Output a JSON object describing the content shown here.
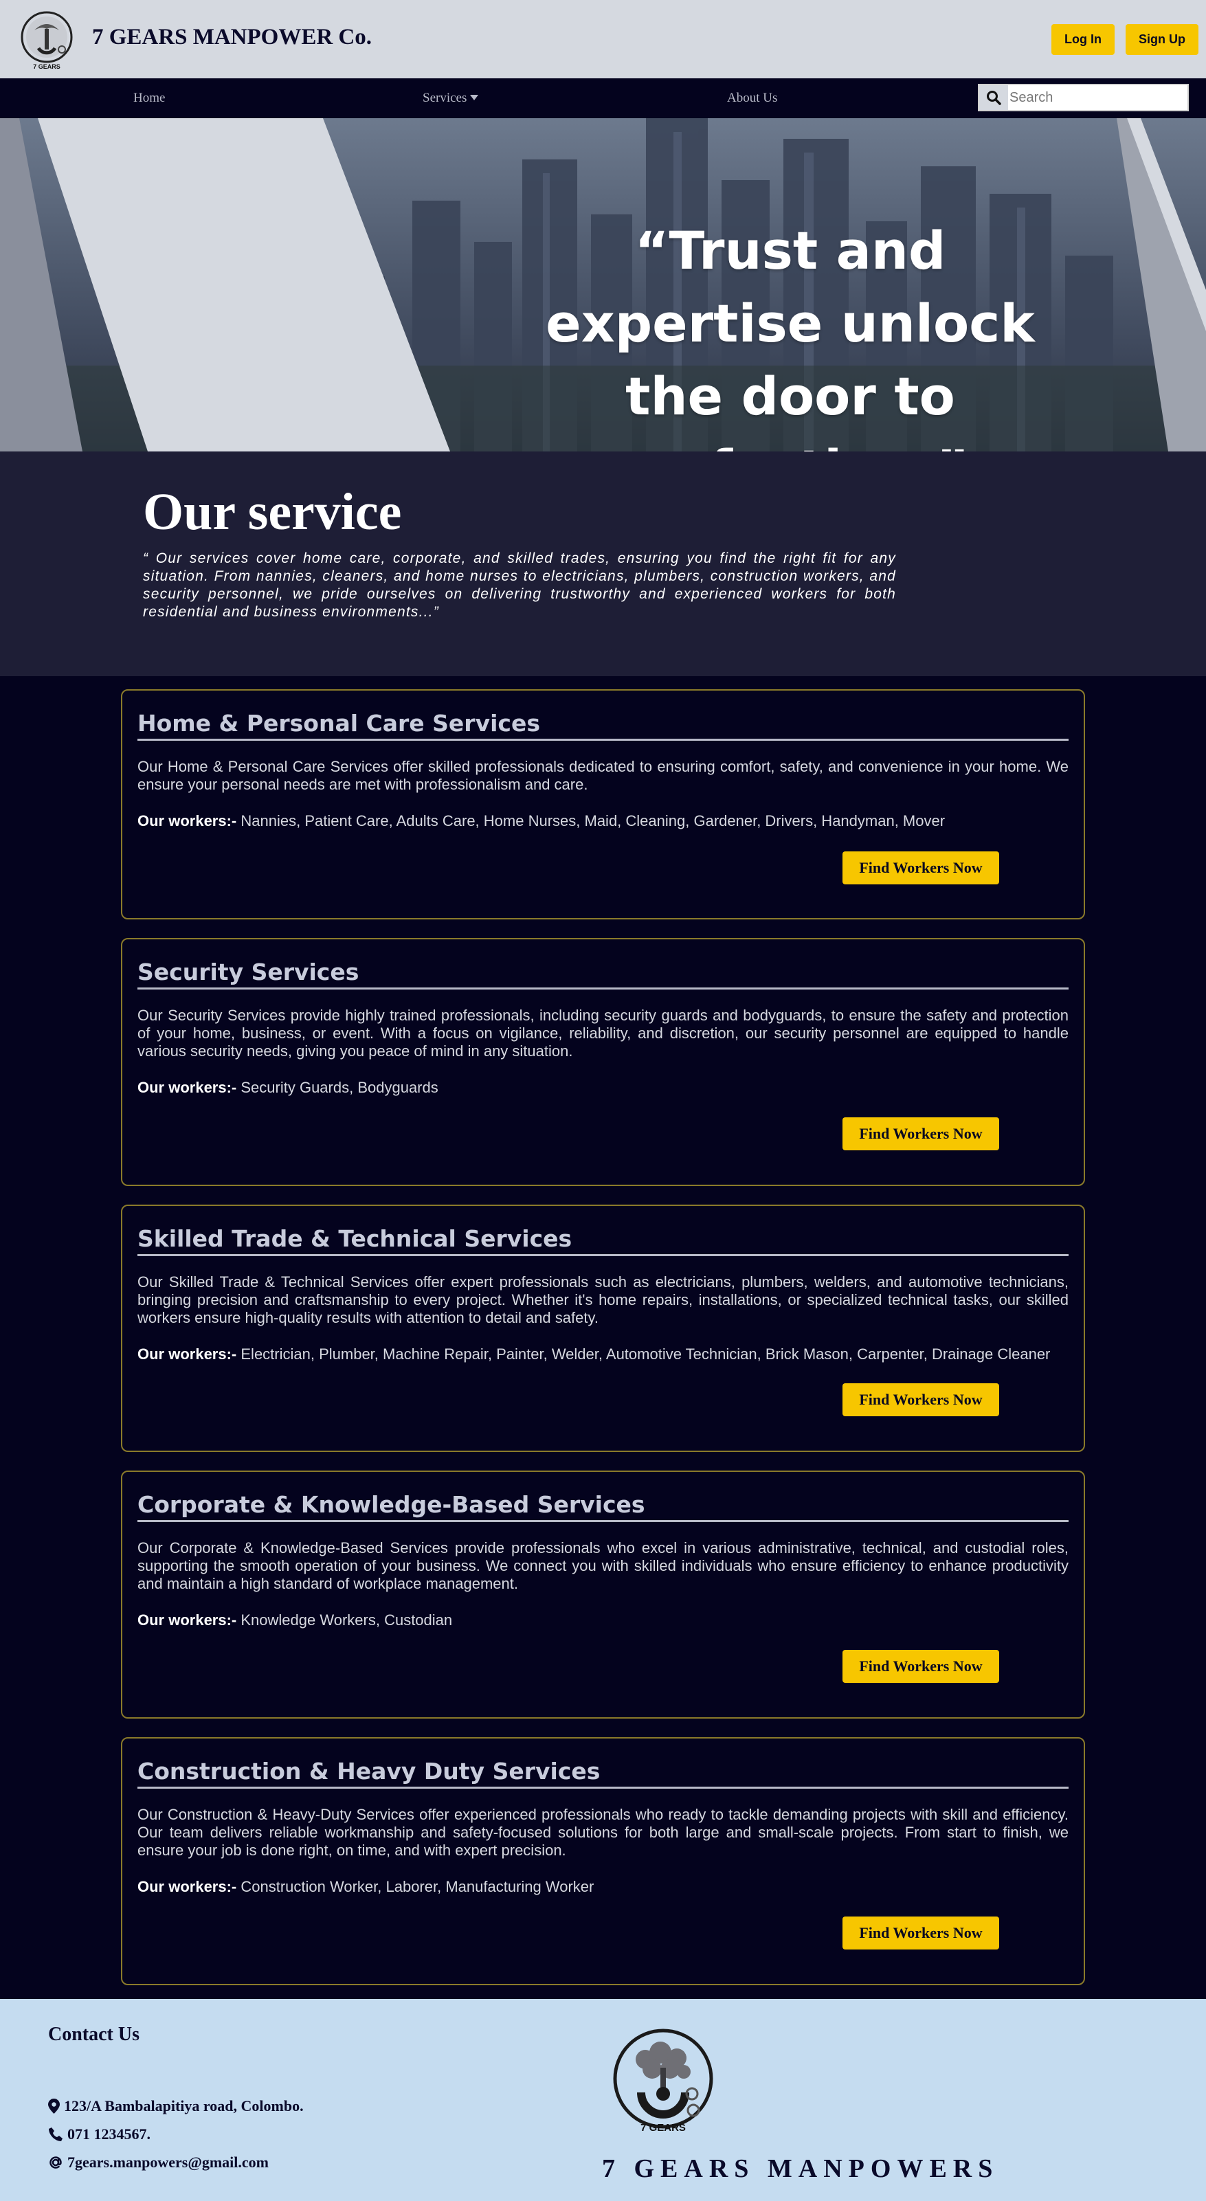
{
  "header": {
    "brand": "7 GEARS MANPOWER Co.",
    "logo_text": "7 GEARS",
    "login_label": "Log In",
    "signup_label": "Sign Up"
  },
  "nav": {
    "home": "Home",
    "services": "Services",
    "about": "About Us",
    "search_placeholder": "Search"
  },
  "hero": {
    "quote": "“Trust and expertise unlock the door to perfection.”"
  },
  "intro": {
    "title": "Our service",
    "text": "“ Our services cover home care, corporate, and skilled trades, ensuring you find the right fit for any situation. From nannies, cleaners, and home nurses to electricians, plumbers, construction workers, and security personnel, we pride ourselves on delivering trustworthy and experienced workers for both residential and business environments...”"
  },
  "services": [
    {
      "title": "Home & Personal Care Services",
      "description": "Our Home & Personal Care Services offer skilled professionals dedicated to ensuring comfort, safety, and convenience in your home. We ensure your personal needs are met with professionalism and care.",
      "workers_label": "Our workers:-",
      "workers": " Nannies, Patient Care, Adults Care, Home Nurses, Maid, Cleaning, Gardener, Drivers, Handyman, Mover",
      "button": "Find Workers Now"
    },
    {
      "title": "Security Services",
      "description": "Our Security Services provide highly trained professionals, including security guards and bodyguards, to ensure the safety and protection of your home, business, or event. With a focus on vigilance, reliability, and discretion, our security personnel are equipped to handle various security needs, giving you peace of mind in any situation.",
      "workers_label": "Our workers:-",
      "workers": " Security Guards, Bodyguards",
      "button": "Find Workers Now"
    },
    {
      "title": "Skilled Trade & Technical Services",
      "description": "Our Skilled Trade & Technical Services offer expert professionals such as electricians, plumbers, welders, and automotive technicians, bringing precision and craftsmanship to every project. Whether it's home repairs, installations, or specialized technical tasks, our skilled workers ensure high-quality results with attention to detail and safety.",
      "workers_label": "Our workers:-",
      "workers": " Electrician, Plumber, Machine Repair, Painter, Welder, Automotive Technician, Brick Mason, Carpenter, Drainage Cleaner",
      "button": "Find Workers Now"
    },
    {
      "title": "Corporate & Knowledge-Based Services",
      "description": "Our Corporate & Knowledge-Based Services provide professionals who excel in various administrative, technical, and custodial roles, supporting the smooth operation of your business. We connect you with skilled individuals who ensure efficiency to enhance productivity and maintain a high standard of workplace management.",
      "workers_label": "Our workers:-",
      "workers": " Knowledge Workers, Custodian",
      "button": "Find Workers Now"
    },
    {
      "title": "Construction & Heavy Duty Services",
      "description": "Our Construction & Heavy-Duty Services offer experienced professionals who ready to tackle demanding projects with skill and efficiency. Our team delivers reliable workmanship and safety-focused solutions for both large and small-scale projects. From start to finish, we ensure your job is done right, on time, and with expert precision.",
      "workers_label": "Our workers:-",
      "workers": " Construction Worker, Laborer, Manufacturing Worker",
      "button": "Find Workers Now"
    }
  ],
  "footer": {
    "contact_title": "Contact Us",
    "address": "123/A Bambalapitiya road, Colombo.",
    "phone": "071 1234567.",
    "email": "7gears.manpowers@gmail.com",
    "brand": "7 GEARS MANPOWERS",
    "logo_text": "7 GEARS"
  },
  "colors": {
    "accent": "#f7c600",
    "page_bg": "#04031e",
    "header_bg": "#d5d9e0",
    "footer_bg": "#c5dcf0",
    "card_border": "#8a7a2a"
  }
}
